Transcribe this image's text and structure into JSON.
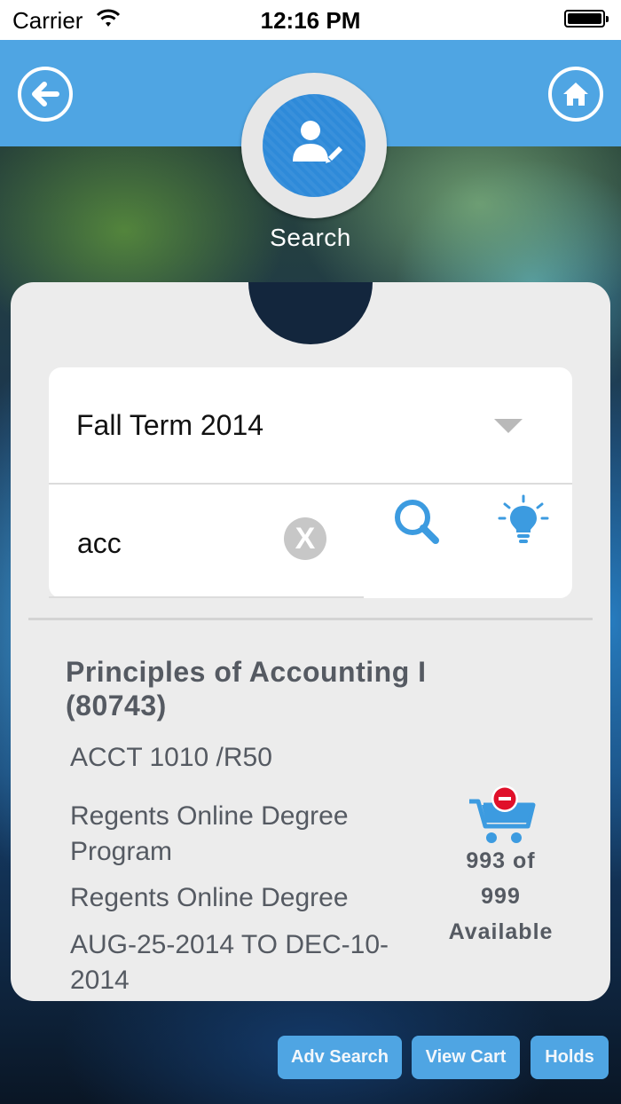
{
  "status_bar": {
    "carrier": "Carrier",
    "time": "12:16 PM"
  },
  "header": {
    "title": "Search",
    "back_icon": "back-arrow-icon",
    "home_icon": "home-icon"
  },
  "search_form": {
    "term": "Fall Term 2014",
    "query": "acc",
    "clear_label": "X"
  },
  "result": {
    "title": "Principles of Accounting I (80743)",
    "code": "ACCT 1010 /R50",
    "program": "Regents Online Degree Program",
    "campus": "Regents Online Degree",
    "dates": "AUG-25-2014 TO DEC-10-2014",
    "seats_line1": "993 of",
    "seats_line2": "999",
    "seats_line3": "Available"
  },
  "buttons": {
    "adv_search": "Adv Search",
    "view_cart": "View Cart",
    "holds": "Holds"
  },
  "colors": {
    "accent": "#4fa5e3",
    "avatar": "#2e8ad9",
    "text": "#555a62",
    "remove": "#e0102a"
  }
}
